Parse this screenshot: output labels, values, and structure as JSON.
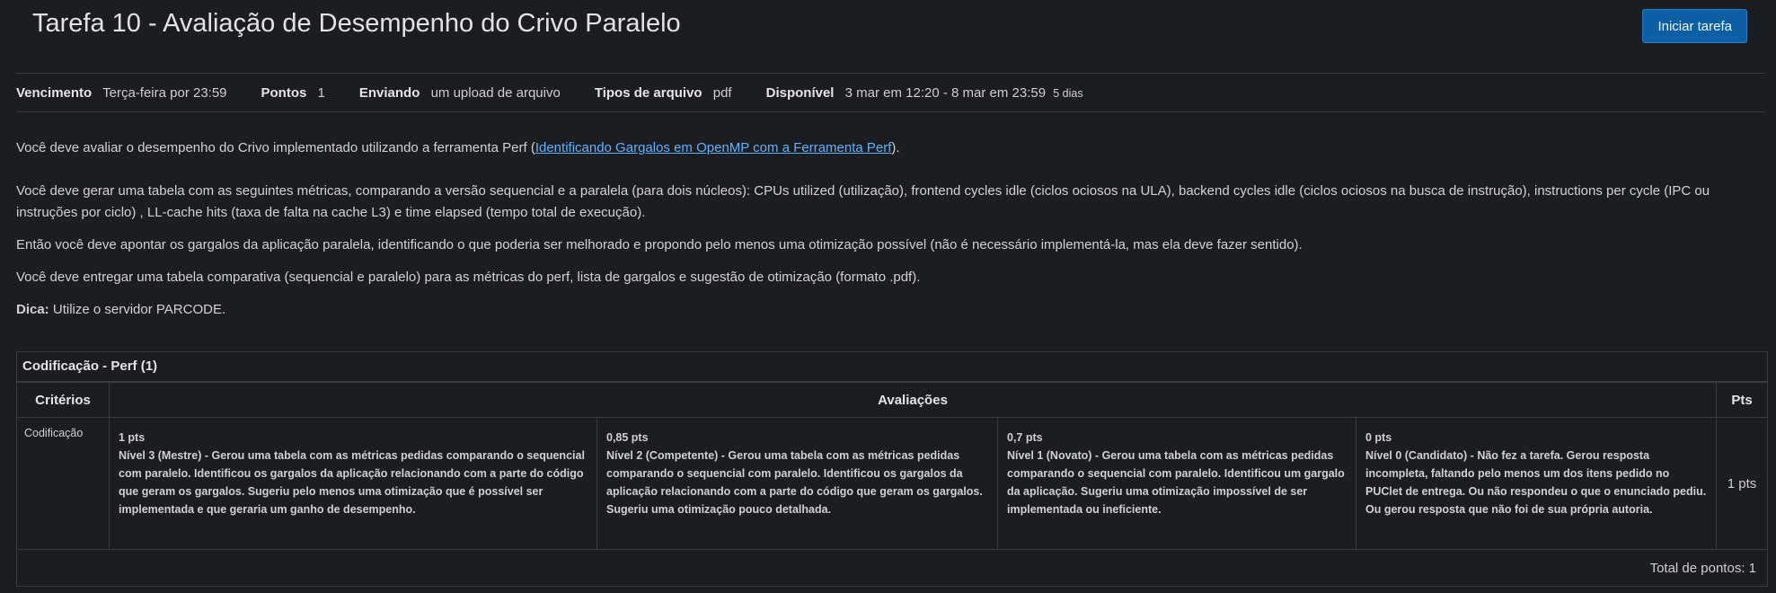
{
  "page": {
    "title": "Tarefa 10 - Avaliação de Desempenho do Crivo Paralelo",
    "start_button": "Iniciar tarefa"
  },
  "meta": {
    "due_label": "Vencimento",
    "due_value": "Terça-feira por 23:59",
    "points_label": "Pontos",
    "points_value": "1",
    "submitting_label": "Enviando",
    "submitting_value": "um upload de arquivo",
    "filetypes_label": "Tipos de arquivo",
    "filetypes_value": "pdf",
    "available_label": "Disponível",
    "available_value": "3 mar em 12:20 - 8 mar em 23:59",
    "available_days": "5 dias"
  },
  "description": {
    "p1_before": "Você deve avaliar o desempenho do Crivo implementado utilizando a ferramenta Perf (",
    "p1_link": "Identificando Gargalos em OpenMP com a Ferramenta Perf",
    "p1_after": ").",
    "p2": "Você deve gerar uma tabela com as seguintes métricas, comparando a versão sequencial e a paralela (para dois núcleos): CPUs utilized (utilização), frontend cycles idle (ciclos ociosos na ULA), backend cycles idle (ciclos ociosos na busca de instrução), instructions per cycle (IPC ou instruções por ciclo) , LL-cache hits (taxa de falta na cache L3) e time elapsed (tempo total de execução).",
    "p3": "Então você deve apontar os gargalos da aplicação paralela, identificando o que poderia ser melhorado e propondo pelo menos uma otimização possível (não é necessário implementá-la, mas ela deve fazer sentido).",
    "p4": "Você deve entregar uma tabela comparativa (sequencial e paralelo) para as métricas do perf, lista de gargalos e sugestão de otimização (formato .pdf).",
    "tip_label": "Dica:",
    "tip_text": " Utilize o servidor PARCODE."
  },
  "rubric": {
    "title": "Codificação - Perf (1)",
    "col_criteria": "Critérios",
    "col_ratings": "Avaliações",
    "col_pts": "Pts",
    "criterion": "Codificação",
    "ratings": [
      {
        "pts": "1 pts",
        "desc": "Nível 3 (Mestre) - Gerou uma tabela com as métricas pedidas comparando o sequencial com paralelo. Identificou os gargalos da aplicação relacionando com a parte do código que geram os gargalos. Sugeriu pelo menos uma otimização que é possível ser implementada e que geraria um ganho de desempenho."
      },
      {
        "pts": "0,85 pts",
        "desc": "Nível 2 (Competente) - Gerou uma tabela com as métricas pedidas comparando o sequencial com paralelo. Identificou os gargalos da aplicação relacionando com a parte do código que geram os gargalos. Sugeriu uma otimização pouco detalhada."
      },
      {
        "pts": "0,7 pts",
        "desc": "Nível 1 (Novato) - Gerou uma tabela com as métricas pedidas comparando o sequencial com paralelo. Identificou um gargalo da aplicação. Sugeriu uma otimização impossível de ser implementada ou ineficiente."
      },
      {
        "pts": "0 pts",
        "desc": "Nível 0 (Candidato) - Não fez a tarefa. Gerou resposta incompleta, faltando pelo menos um dos itens pedido no PUClet de entrega. Ou não respondeu o que o enunciado pediu. Ou gerou resposta que não foi de sua própria autoria."
      }
    ],
    "row_pts": "1 pts",
    "total": "Total de pontos: 1"
  }
}
